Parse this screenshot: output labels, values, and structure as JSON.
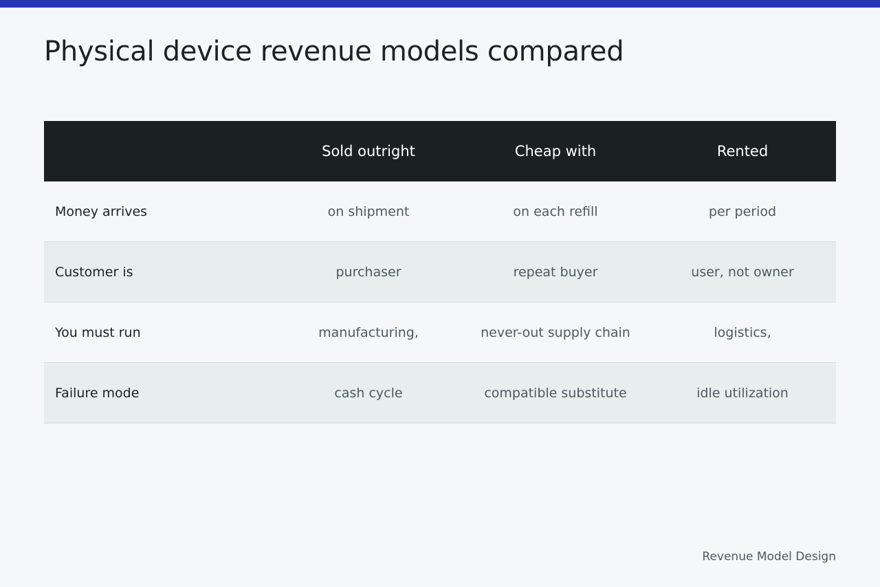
{
  "title": "Physical device revenue models compared",
  "footer": "Revenue Model Design",
  "colors": {
    "accent_bar": "#2635b8",
    "header_bg": "#1b2023",
    "alt_row_bg": "#e8edee",
    "page_bg": "#f5f7f9"
  },
  "table": {
    "headers": [
      "",
      "Sold outright",
      "Cheap with",
      "Rented"
    ],
    "rows": [
      {
        "label": "Money arrives",
        "cells": [
          "on shipment",
          "on each refill",
          "per period"
        ]
      },
      {
        "label": "Customer is",
        "cells": [
          "purchaser",
          "repeat buyer",
          "user, not owner"
        ]
      },
      {
        "label": "You must run",
        "cells": [
          "manufacturing,",
          "never-out supply chain",
          "logistics,"
        ]
      },
      {
        "label": "Failure mode",
        "cells": [
          "cash cycle",
          "compatible substitute",
          "idle utilization"
        ]
      }
    ]
  }
}
